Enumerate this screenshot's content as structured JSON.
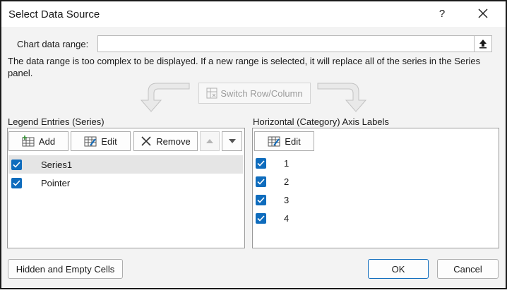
{
  "window": {
    "title": "Select Data Source",
    "help": "?",
    "close": "✕"
  },
  "range": {
    "label": "Chart data range:",
    "value": ""
  },
  "message": {
    "line1": "The data range is too complex to be displayed. If a new range is selected, it will replace all of the series in the Series",
    "line2": "panel."
  },
  "switch": {
    "label": "Switch Row/Column"
  },
  "legend": {
    "heading": "Legend Entries (Series)",
    "add": "Add",
    "edit": "Edit",
    "remove": "Remove",
    "items": [
      {
        "label": "Series1",
        "checked": true,
        "selected": true
      },
      {
        "label": "Pointer",
        "checked": true,
        "selected": false
      }
    ]
  },
  "axis": {
    "heading": "Horizontal (Category) Axis Labels",
    "edit": "Edit",
    "items": [
      {
        "label": "1",
        "checked": true
      },
      {
        "label": "2",
        "checked": true
      },
      {
        "label": "3",
        "checked": true
      },
      {
        "label": "4",
        "checked": true
      }
    ]
  },
  "footer": {
    "hidden_cells": "Hidden and Empty Cells",
    "ok": "OK",
    "cancel": "Cancel"
  },
  "colors": {
    "checkbox": "#0f6cbd",
    "selection": "#e5e5e5",
    "dialog_bg": "#f3f3f3"
  }
}
